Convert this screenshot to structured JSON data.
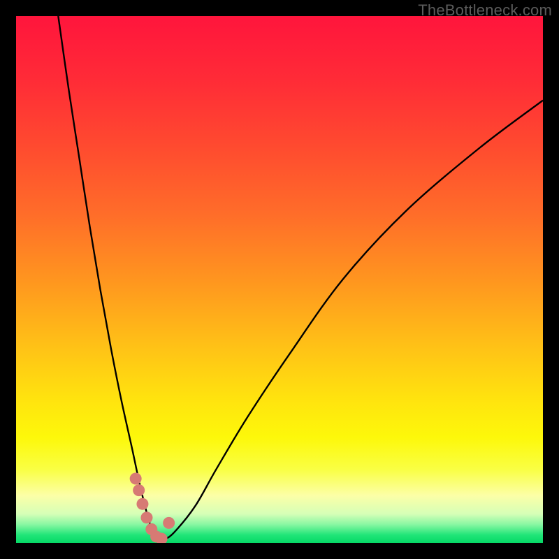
{
  "watermark": "TheBottleneck.com",
  "colors": {
    "frame": "#000000",
    "curve_stroke": "#000000",
    "marker_fill": "#d77a74",
    "gradient_stops": [
      {
        "offset": 0.0,
        "color": "#ff153c"
      },
      {
        "offset": 0.12,
        "color": "#ff2b37"
      },
      {
        "offset": 0.25,
        "color": "#ff4b2f"
      },
      {
        "offset": 0.38,
        "color": "#ff6e29"
      },
      {
        "offset": 0.5,
        "color": "#ff951f"
      },
      {
        "offset": 0.62,
        "color": "#ffbf17"
      },
      {
        "offset": 0.73,
        "color": "#ffe40e"
      },
      {
        "offset": 0.8,
        "color": "#fdf80a"
      },
      {
        "offset": 0.86,
        "color": "#f9ff43"
      },
      {
        "offset": 0.91,
        "color": "#fcffa7"
      },
      {
        "offset": 0.945,
        "color": "#d6ffb7"
      },
      {
        "offset": 0.965,
        "color": "#88f7a2"
      },
      {
        "offset": 0.985,
        "color": "#20e578"
      },
      {
        "offset": 1.0,
        "color": "#06d966"
      }
    ]
  },
  "chart_data": {
    "type": "line",
    "title": "",
    "xlabel": "",
    "ylabel": "",
    "xlim": [
      0,
      100
    ],
    "ylim": [
      0,
      100
    ],
    "series": [
      {
        "name": "bottleneck-curve",
        "x": [
          8,
          10,
          12,
          14,
          16,
          18,
          20,
          22,
          23.5,
          25,
          26,
          27,
          28,
          30,
          34,
          38,
          44,
          52,
          62,
          74,
          88,
          100
        ],
        "y": [
          100,
          86,
          73,
          60,
          48,
          37,
          27,
          18,
          11,
          5,
          2,
          0.6,
          0.6,
          2,
          7,
          14,
          24,
          36,
          50,
          63,
          75,
          84
        ]
      }
    ],
    "markers": {
      "name": "highlighted-points",
      "x": [
        22.7,
        23.3,
        24.0,
        24.8,
        25.7,
        26.6,
        27.6,
        29.0
      ],
      "y": [
        12.2,
        10.0,
        7.4,
        4.8,
        2.6,
        1.2,
        0.8,
        3.8
      ]
    }
  }
}
